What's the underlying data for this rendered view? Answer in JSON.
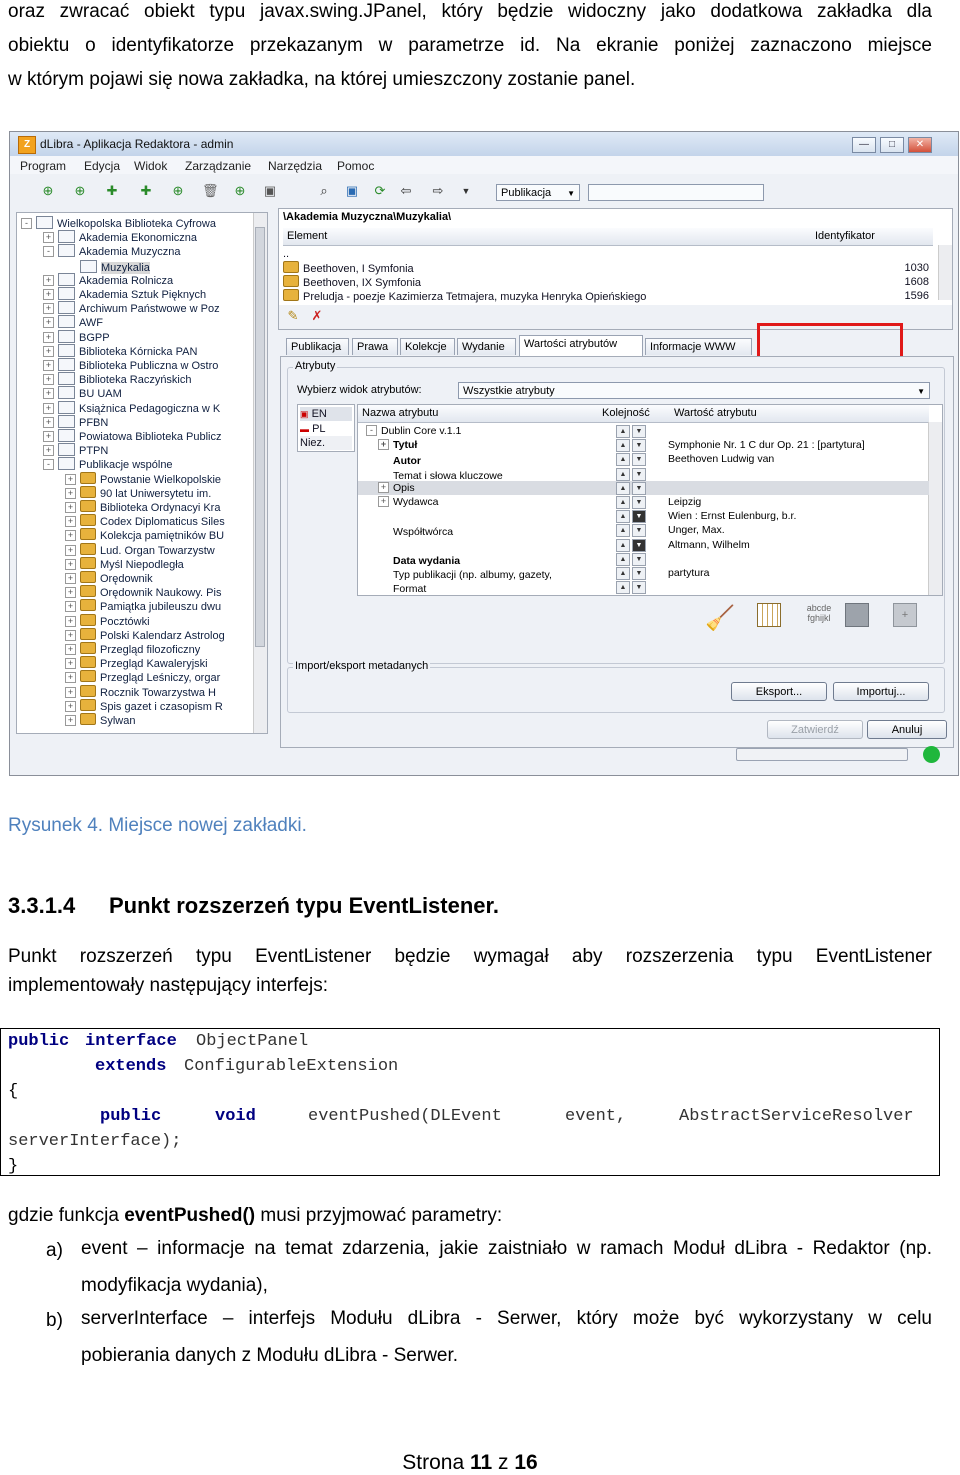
{
  "intro": {
    "line1": "oraz zwracać obiekt typu javax.swing.JPanel, który będzie widoczny jako dodatkowa zakładka dla",
    "line2": "obiektu o identyfikatorze przekazanym w parametrze id. Na ekranie poniżej zaznaczono miejsce",
    "line3": "w którym pojawi się nowa zakładka, na której umieszczony zostanie panel."
  },
  "screenshot": {
    "title": "dLibra - Aplikacja Redaktora - admin",
    "menu": [
      "Program",
      "Edycja",
      "Widok",
      "Zarządzanie",
      "Narzędzia",
      "Pomoc"
    ],
    "toolbar_combo": "Publikacja",
    "tree": [
      {
        "label": "Wielkopolska Biblioteka Cyfrowa",
        "level": 0,
        "kind": "folder",
        "exp": "-"
      },
      {
        "label": "Akademia Ekonomiczna",
        "level": 1,
        "kind": "folder",
        "exp": "+"
      },
      {
        "label": "Akademia Muzyczna",
        "level": 1,
        "kind": "folder",
        "exp": "-"
      },
      {
        "label": "Muzykalia",
        "level": 2,
        "kind": "folder",
        "exp": "",
        "selected": true
      },
      {
        "label": "Akademia Rolnicza",
        "level": 1,
        "kind": "folder",
        "exp": "+"
      },
      {
        "label": "Akademia Sztuk Pięknych",
        "level": 1,
        "kind": "folder",
        "exp": "+"
      },
      {
        "label": "Archiwum Państwowe w Poz",
        "level": 1,
        "kind": "folder",
        "exp": "+"
      },
      {
        "label": "AWF",
        "level": 1,
        "kind": "folder",
        "exp": "+"
      },
      {
        "label": "BGPP",
        "level": 1,
        "kind": "folder",
        "exp": "+"
      },
      {
        "label": "Biblioteka Kórnicka PAN",
        "level": 1,
        "kind": "folder",
        "exp": "+"
      },
      {
        "label": "Biblioteka Publiczna w Ostro",
        "level": 1,
        "kind": "folder",
        "exp": "+"
      },
      {
        "label": "Biblioteka Raczyńskich",
        "level": 1,
        "kind": "folder",
        "exp": "+"
      },
      {
        "label": "BU UAM",
        "level": 1,
        "kind": "folder",
        "exp": "+"
      },
      {
        "label": "Książnica Pedagogiczna w K",
        "level": 1,
        "kind": "folder",
        "exp": "+"
      },
      {
        "label": "PFBN",
        "level": 1,
        "kind": "folder",
        "exp": "+"
      },
      {
        "label": "Powiatowa Biblioteka Publicz",
        "level": 1,
        "kind": "folder",
        "exp": "+"
      },
      {
        "label": "PTPN",
        "level": 1,
        "kind": "folder",
        "exp": "+"
      },
      {
        "label": "Publikacje wspólne",
        "level": 1,
        "kind": "folder",
        "exp": "-"
      },
      {
        "label": "Powstanie Wielkopolskie",
        "level": 2,
        "kind": "pub",
        "exp": "+"
      },
      {
        "label": "90 lat Uniwersytetu im.",
        "level": 2,
        "kind": "pub",
        "exp": "+"
      },
      {
        "label": "Biblioteka Ordynacyi Kra",
        "level": 2,
        "kind": "pub",
        "exp": "+"
      },
      {
        "label": "Codex Diplomaticus Siles",
        "level": 2,
        "kind": "pub",
        "exp": "+"
      },
      {
        "label": "Kolekcja pamiętników BU",
        "level": 2,
        "kind": "pub",
        "exp": "+"
      },
      {
        "label": "Lud. Organ Towarzystw",
        "level": 2,
        "kind": "pub",
        "exp": "+"
      },
      {
        "label": "Myśl Niepodległa",
        "level": 2,
        "kind": "pub",
        "exp": "+"
      },
      {
        "label": "Orędownik",
        "level": 2,
        "kind": "pub",
        "exp": "+"
      },
      {
        "label": "Orędownik Naukowy. Pis",
        "level": 2,
        "kind": "pub",
        "exp": "+"
      },
      {
        "label": "Pamiątka jubileuszu dwu",
        "level": 2,
        "kind": "pub",
        "exp": "+"
      },
      {
        "label": "Pocztówki",
        "level": 2,
        "kind": "pub",
        "exp": "+"
      },
      {
        "label": "Polski Kalendarz Astrolog",
        "level": 2,
        "kind": "pub",
        "exp": "+"
      },
      {
        "label": "Przegląd filozoficzny",
        "level": 2,
        "kind": "pub",
        "exp": "+"
      },
      {
        "label": "Przegląd Kawaleryjski",
        "level": 2,
        "kind": "pub",
        "exp": "+"
      },
      {
        "label": "Przegląd Leśniczy, orgar",
        "level": 2,
        "kind": "pub",
        "exp": "+"
      },
      {
        "label": "Rocznik Towarzystwa H",
        "level": 2,
        "kind": "pub",
        "exp": "+"
      },
      {
        "label": "Spis gazet i czasopism R",
        "level": 2,
        "kind": "pub",
        "exp": "+"
      },
      {
        "label": "Sylwan",
        "level": 2,
        "kind": "pub",
        "exp": "+"
      }
    ],
    "path": "\\Akademia Muzyczna\\Muzykalia\\",
    "list_headers": {
      "element": "Element",
      "id": "Identyfikator"
    },
    "list_up": "..",
    "list_rows": [
      {
        "name": "Beethoven, I Symfonia",
        "id": "1030"
      },
      {
        "name": "Beethoven, IX Symfonia",
        "id": "1608"
      },
      {
        "name": "Preludja - poezje Kazimierza Tetmajera, muzyka Henryka Opieńskiego",
        "id": "1596"
      }
    ],
    "tabs": [
      "Publikacja",
      "Prawa",
      "Kolekcje",
      "Wydanie",
      "Wartości atrybutów",
      "Informacje WWW"
    ],
    "attr_group": "Atrybuty",
    "view_label": "Wybierz widok atrybutów:",
    "view_value": "Wszystkie atrybuty",
    "langs": [
      "EN",
      "PL",
      "Niez."
    ],
    "attr_headers": {
      "name": "Nazwa atrybutu",
      "order": "Kolejność",
      "value": "Wartość atrybutu"
    },
    "attr_rows": [
      {
        "name": "Dublin Core v.1.1",
        "value": "",
        "exp": "-",
        "indent": 0,
        "bold": false,
        "shade": false
      },
      {
        "name": "Tytuł",
        "value": "Symphonie Nr. 1 C dur Op. 21 : [partytura]",
        "exp": "+",
        "indent": 1,
        "bold": true,
        "shade": false
      },
      {
        "name": "Autor",
        "value": "Beethoven Ludwig van",
        "exp": "",
        "indent": 1,
        "bold": true,
        "shade": false
      },
      {
        "name": "Temat i słowa kluczowe",
        "value": "",
        "exp": "",
        "indent": 1,
        "bold": false,
        "shade": false
      },
      {
        "name": "Opis",
        "value": "",
        "exp": "+",
        "indent": 1,
        "bold": false,
        "shade": true
      },
      {
        "name": "Wydawca",
        "value": "Leipzig",
        "exp": "+",
        "indent": 1,
        "bold": false,
        "shade": false
      },
      {
        "name": "",
        "value": "Wien : Ernst Eulenburg, b.r.",
        "exp": "",
        "indent": 1,
        "bold": false,
        "shade": false
      },
      {
        "name": "Współtwórca",
        "value": "Unger, Max.",
        "exp": "",
        "indent": 1,
        "bold": false,
        "shade": false
      },
      {
        "name": "",
        "value": "Altmann, Wilhelm",
        "exp": "",
        "indent": 1,
        "bold": false,
        "shade": false
      },
      {
        "name": "Data wydania",
        "value": "",
        "exp": "",
        "indent": 1,
        "bold": true,
        "shade": false
      },
      {
        "name": "Typ publikacji (np. albumy, gazety,",
        "value": "partytura",
        "exp": "",
        "indent": 1,
        "bold": false,
        "shade": false
      },
      {
        "name": "Format",
        "value": "",
        "exp": "",
        "indent": 1,
        "bold": false,
        "shade": false
      }
    ],
    "font_sample_line1": "abcde",
    "font_sample_line2": "fghijkl",
    "import_group": "Import/eksport metadanych",
    "export_btn": "Eksport...",
    "import_btn": "Importuj...",
    "confirm_btn": "Zatwierdź",
    "cancel_btn": "Anuluj"
  },
  "caption": "Rysunek 4. Miejsce nowej zakładki.",
  "heading": {
    "number": "3.3.1.4",
    "title": "Punkt rozszerzeń typu EventListener."
  },
  "para": {
    "line1": "Punkt rozszerzeń typu EventListener będzie wymagał aby rozszerzenia typu EventListener",
    "line2": "implementowały następujący interfejs:"
  },
  "code": {
    "kw_public": "public",
    "kw_interface": "interface",
    "name": "ObjectPanel",
    "kw_extends": "extends",
    "parent": "ConfigurableExtension",
    "open": "{",
    "kw_public2": "public",
    "kw_void": "void",
    "method": "eventPushed(DLEvent",
    "arg1": "event,",
    "arg2type": "AbstractServiceResolver",
    "arg2": "serverInterface);",
    "close": "}"
  },
  "params_intro": {
    "prefix": "gdzie funkcja ",
    "fn": "eventPushed()",
    "suffix": " musi przyjmować parametry:"
  },
  "list": [
    {
      "marker": "a)",
      "term": "event",
      "line1": " – informacje na temat zdarzenia, jakie zaistniało w ramach Moduł dLibra - Redaktor (np.",
      "line2": "modyfikacja wydania),"
    },
    {
      "marker": "b)",
      "term": "serverInterface",
      "line1": " – interfejs Modułu dLibra - Serwer, który może być wykorzystany w celu",
      "line2": "pobierania danych z Modułu dLibra - Serwer."
    }
  ],
  "footer": {
    "prefix": "Strona ",
    "page": "11",
    "mid": " z ",
    "total": "16"
  }
}
